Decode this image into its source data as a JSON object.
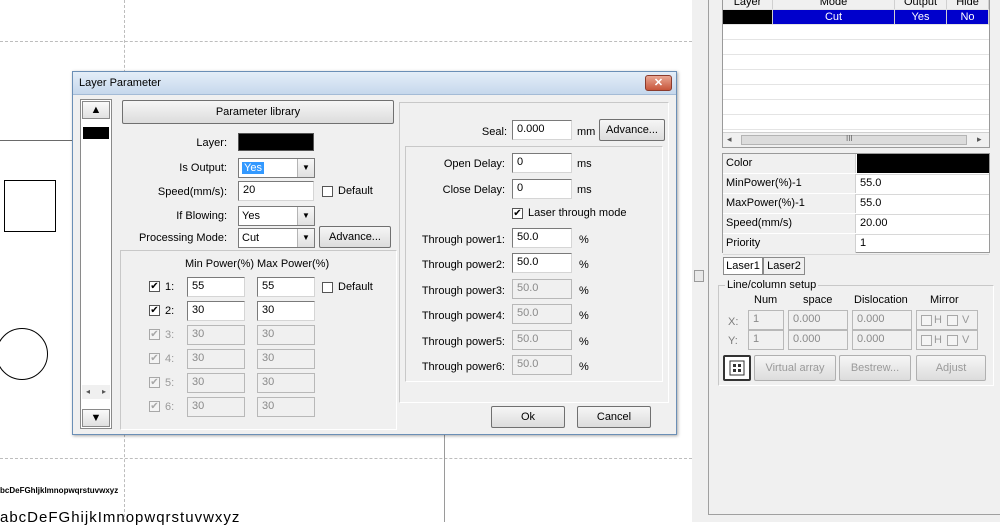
{
  "canvas": {
    "sample_text_small": "bcDeFGhIjklmnopwqrstuvwxyz",
    "sample_text_large": "abcDeFGhijkImnopwqrstuvwxyz"
  },
  "dialog": {
    "title": "Layer Parameter",
    "close_glyph": "✕",
    "parameter_library_label": "Parameter library",
    "layer_label": "Layer:",
    "is_output_label": "Is Output:",
    "is_output_value": "Yes",
    "speed_label": "Speed(mm/s):",
    "speed_value": "20",
    "default_label": "Default",
    "if_blowing_label": "If Blowing:",
    "if_blowing_value": "Yes",
    "processing_mode_label": "Processing Mode:",
    "processing_mode_value": "Cut",
    "advance_label": "Advance...",
    "min_power_header": "Min Power(%)",
    "max_power_header": "Max Power(%)",
    "power_default_label": "Default",
    "power_rows": [
      {
        "label": "1:",
        "min": "55",
        "max": "55",
        "checked": "✔"
      },
      {
        "label": "2:",
        "min": "30",
        "max": "30",
        "checked": "✔"
      },
      {
        "label": "3:",
        "min": "30",
        "max": "30",
        "checked": "✔"
      },
      {
        "label": "4:",
        "min": "30",
        "max": "30",
        "checked": "✔"
      },
      {
        "label": "5:",
        "min": "30",
        "max": "30",
        "checked": "✔"
      },
      {
        "label": "6:",
        "min": "30",
        "max": "30",
        "checked": "✔"
      }
    ],
    "seal_label": "Seal:",
    "seal_value": "0.000",
    "seal_unit": "mm",
    "seal_advance_label": "Advance...",
    "open_delay_label": "Open Delay:",
    "open_delay_value": "0",
    "close_delay_label": "Close Delay:",
    "close_delay_value": "0",
    "ms_unit": "ms",
    "laser_through_label": "Laser through mode",
    "through_powers": [
      {
        "label": "Through power1:",
        "value": "50.0"
      },
      {
        "label": "Through power2:",
        "value": "50.0"
      },
      {
        "label": "Through power3:",
        "value": "50.0"
      },
      {
        "label": "Through power4:",
        "value": "50.0"
      },
      {
        "label": "Through power5:",
        "value": "50.0"
      },
      {
        "label": "Through power6:",
        "value": "50.0"
      }
    ],
    "percent_unit": "%",
    "ok_label": "Ok",
    "cancel_label": "Cancel",
    "check_glyph": "✔"
  },
  "layer_table": {
    "headers": [
      "Layer",
      "Mode",
      "Output",
      "Hide"
    ],
    "row": {
      "mode": "Cut",
      "output": "Yes",
      "hide": "No"
    },
    "scroll_mid": "III"
  },
  "properties": [
    {
      "key": "Color",
      "value": ""
    },
    {
      "key": "MinPower(%)-1",
      "value": "55.0"
    },
    {
      "key": "MaxPower(%)-1",
      "value": "55.0"
    },
    {
      "key": "Speed(mm/s)",
      "value": "20.00"
    },
    {
      "key": "Priority",
      "value": "1"
    }
  ],
  "laser_tabs": [
    "Laser1",
    "Laser2"
  ],
  "array_setup": {
    "group_title": "Line/column setup",
    "headers": [
      "Num",
      "space",
      "Dislocation",
      "Mirror"
    ],
    "x_label": "X:",
    "y_label": "Y:",
    "x": {
      "num": "1",
      "space": "0.000",
      "dislocation": "0.000"
    },
    "y": {
      "num": "1",
      "space": "0.000",
      "dislocation": "0.000"
    },
    "h_label": "H",
    "v_label": "V",
    "virtual_array_label": "Virtual array",
    "bestrew_label": "Bestrew...",
    "adjust_label": "Adjust"
  },
  "colors": {
    "layer_color": "#000000",
    "selection": "#0000cc"
  }
}
